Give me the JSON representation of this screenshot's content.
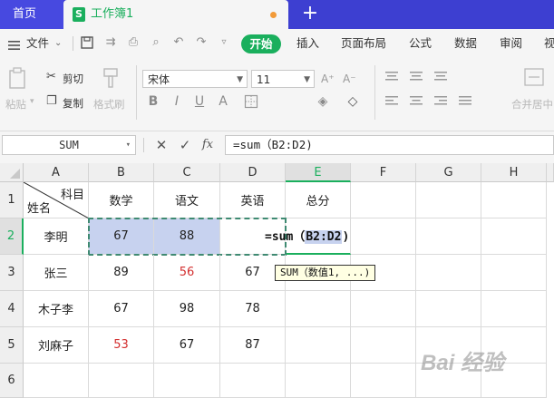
{
  "tabs": {
    "home": "首页",
    "doc": "工作簿1",
    "doc_icon": "S",
    "add": "+"
  },
  "menu": {
    "file": "文件",
    "items": [
      "开始",
      "插入",
      "页面布局",
      "公式",
      "数据",
      "审阅",
      "视"
    ]
  },
  "ribbon": {
    "paste": "粘贴",
    "cut": "剪切",
    "copy": "复制",
    "format_painter": "格式刷",
    "font_name": "宋体",
    "font_size": "11",
    "merge": "合并居中"
  },
  "formula_bar": {
    "name_box": "SUM",
    "fx": "fx",
    "formula": "=sum（B2:D2)"
  },
  "columns": [
    "A",
    "B",
    "C",
    "D",
    "E",
    "F",
    "G",
    "H"
  ],
  "rows": [
    "1",
    "2",
    "3",
    "4",
    "5",
    "6"
  ],
  "header_row": {
    "corner_top": "科目",
    "corner_bottom": "姓名",
    "cols": [
      "数学",
      "语文",
      "英语",
      "总分"
    ]
  },
  "data_rows": [
    {
      "name": "李明",
      "math": "67",
      "chinese": "88",
      "english": ""
    },
    {
      "name": "张三",
      "math": "89",
      "chinese": "56",
      "english": "67"
    },
    {
      "name": "木子李",
      "math": "67",
      "chinese": "98",
      "english": "78"
    },
    {
      "name": "刘麻子",
      "math": "53",
      "chinese": "67",
      "english": "87"
    }
  ],
  "editing": {
    "prefix": "=sum（",
    "ref": "B2:D2",
    "suffix": ")"
  },
  "tooltip": "SUM（数值1, ...)",
  "watermark": "Bai 经验",
  "colors": {
    "accent": "#1aaf5d",
    "tabbar": "#3d3fd1",
    "red": "#d32f2f",
    "selection": "#c7d2ef"
  }
}
